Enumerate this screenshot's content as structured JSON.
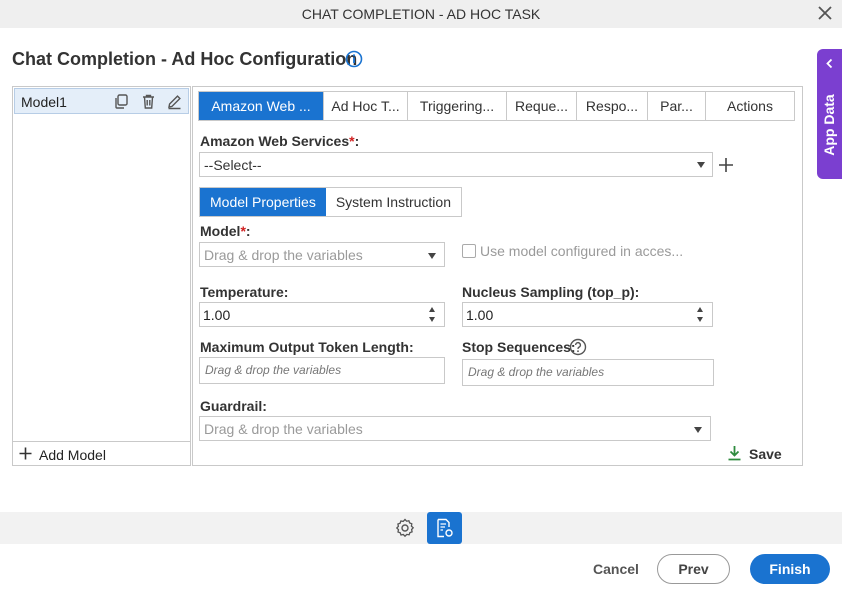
{
  "window": {
    "title": "CHAT COMPLETION - AD HOC TASK"
  },
  "page": {
    "heading": "Chat Completion - Ad Hoc Configuration"
  },
  "app_data_tab": {
    "label": "App Data"
  },
  "models": {
    "items": [
      {
        "name": "Model1"
      }
    ],
    "add_label": "Add Model"
  },
  "tabs": [
    {
      "label": "Amazon Web ...",
      "active": true
    },
    {
      "label": "Ad Hoc T..."
    },
    {
      "label": "Triggering..."
    },
    {
      "label": "Reque..."
    },
    {
      "label": "Respo..."
    },
    {
      "label": "Par..."
    },
    {
      "label": "Actions"
    }
  ],
  "aws": {
    "label": "Amazon Web Services",
    "required_mark": "*",
    "suffix": ":",
    "value": "--Select--"
  },
  "subtabs": [
    {
      "label": "Model Properties",
      "active": true
    },
    {
      "label": "System Instruction"
    }
  ],
  "form": {
    "model_label": "Model",
    "model_required": "*",
    "model_suffix": ":",
    "model_placeholder": "Drag & drop the variables",
    "use_model_checkbox": "Use model configured in acces...",
    "temperature_label": "Temperature:",
    "temperature_value": "1.00",
    "top_p_label": "Nucleus Sampling (top_p):",
    "top_p_value": "1.00",
    "max_tokens_label": "Maximum Output Token Length:",
    "max_tokens_placeholder": "Drag & drop the variables",
    "stop_seq_label": "Stop Sequences:",
    "stop_seq_placeholder": "Drag & drop the variables",
    "guardrail_label": "Guardrail:",
    "guardrail_placeholder": "Drag & drop the variables",
    "save_label": "Save"
  },
  "footer": {
    "cancel": "Cancel",
    "prev": "Prev",
    "finish": "Finish"
  },
  "colors": {
    "accent": "#1a73d0",
    "app_data": "#7b3fd0",
    "save_icon": "#2e8b3e",
    "required": "#d02020"
  }
}
